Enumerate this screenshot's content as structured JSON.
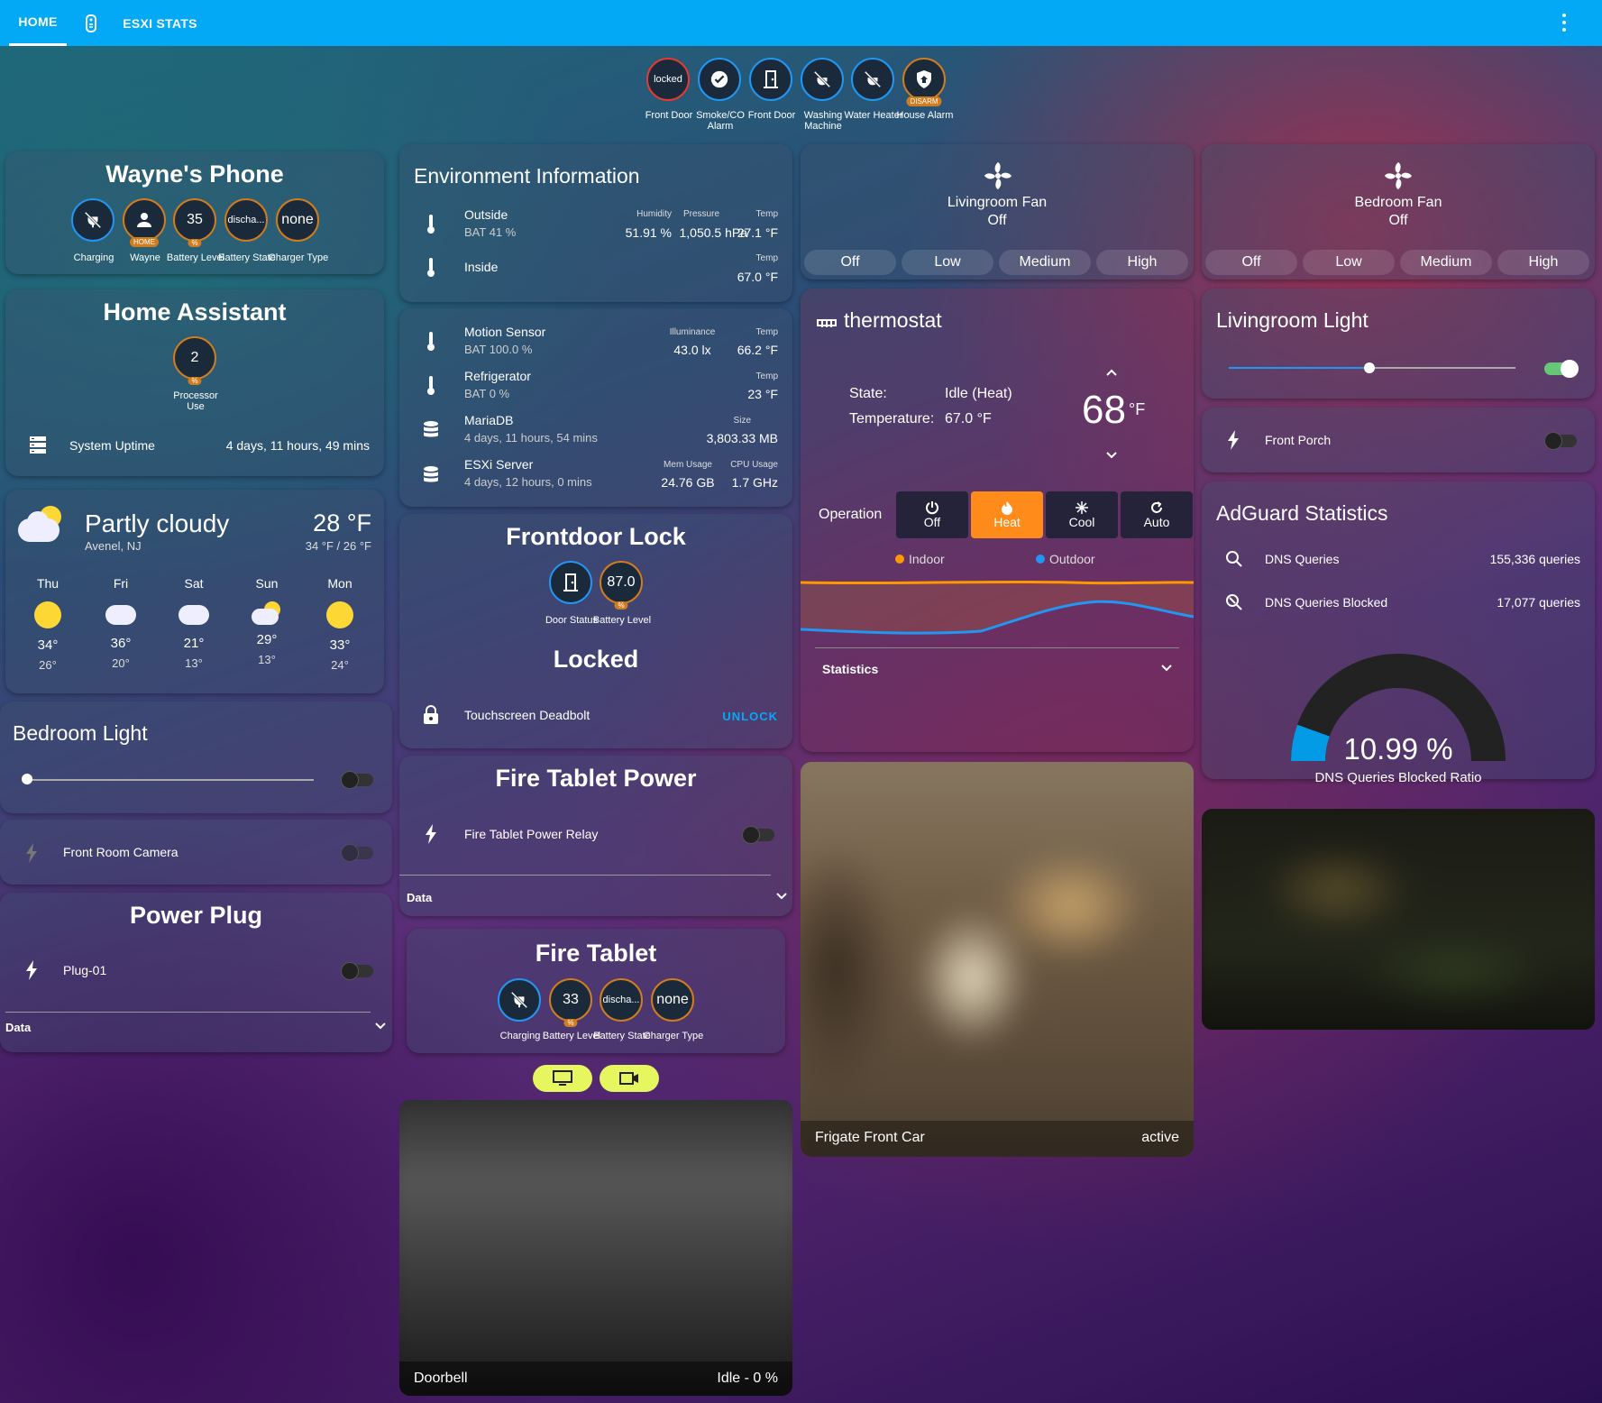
{
  "topbar": {
    "tabs": [
      {
        "label": "HOME"
      },
      {
        "label": "ESXI STATS"
      }
    ]
  },
  "status_badges": [
    {
      "value": "locked",
      "label": "Front Door",
      "icon": "lock-icon"
    },
    {
      "value": "",
      "label": "Smoke/CO Alarm",
      "icon": "check-icon"
    },
    {
      "value": "",
      "label": "Front Door",
      "icon": "door-icon"
    },
    {
      "value": "",
      "label": "Washing Machine",
      "icon": "power-off-icon"
    },
    {
      "value": "",
      "label": "Water Heater",
      "icon": "power-off-icon"
    },
    {
      "value": "",
      "label": "House Alarm",
      "icon": "shield-home-icon",
      "chip": "DISARM"
    }
  ],
  "phone": {
    "title": "Wayne's Phone",
    "badges": [
      {
        "value": "",
        "label": "Charging",
        "icon": "power-plug-off-icon"
      },
      {
        "value": "",
        "label": "Wayne",
        "icon": "person-icon",
        "chip": "HOME"
      },
      {
        "value": "35",
        "label": "Battery Level",
        "chip": "%"
      },
      {
        "value": "discha...",
        "label": "Battery State"
      },
      {
        "value": "none",
        "label": "Charger Type"
      }
    ]
  },
  "ha": {
    "title": "Home Assistant",
    "badge": {
      "value": "2",
      "label": "Processor Use",
      "chip": "%"
    },
    "uptime_label": "System Uptime",
    "uptime_value": "4 days, 11 hours, 49 mins"
  },
  "weather": {
    "condition": "Partly cloudy",
    "location": "Avenel, NJ",
    "temp": "28 °F",
    "hilo": "34 °F / 26 °F",
    "forecast": [
      {
        "day": "Thu",
        "high": "34°",
        "low": "26°",
        "icon": "sunny"
      },
      {
        "day": "Fri",
        "high": "36°",
        "low": "20°",
        "icon": "snowy"
      },
      {
        "day": "Sat",
        "high": "21°",
        "low": "13°",
        "icon": "snowy"
      },
      {
        "day": "Sun",
        "high": "29°",
        "low": "13°",
        "icon": "partly-cloudy"
      },
      {
        "day": "Mon",
        "high": "33°",
        "low": "24°",
        "icon": "sunny"
      }
    ]
  },
  "bedroom_light": {
    "title": "Bedroom Light",
    "level": 0,
    "on": false
  },
  "front_room_camera": {
    "label": "Front Room Camera",
    "on": false
  },
  "power_plug": {
    "title": "Power Plug",
    "item": "Plug-01",
    "on": false,
    "footer": "Data"
  },
  "env": {
    "title": "Environment Information",
    "outside": {
      "name": "Outside",
      "bat": "BAT 41 %",
      "h_label": "Humidity",
      "h": "51.91 %",
      "p_label": "Pressure",
      "p": "1,050.5 hPa",
      "t_label": "Temp",
      "t": "27.1 °F"
    },
    "inside": {
      "name": "Inside",
      "t_label": "Temp",
      "t": "67.0 °F"
    }
  },
  "sensors": {
    "motion": {
      "name": "Motion Sensor",
      "bat": "BAT 100.0 %",
      "i_label": "Illuminance",
      "i": "43.0 lx",
      "t_label": "Temp",
      "t": "66.2 °F"
    },
    "fridge": {
      "name": "Refrigerator",
      "bat": "BAT 0 %",
      "t_label": "Temp",
      "t": "23 °F"
    },
    "mariadb": {
      "name": "MariaDB",
      "sub": "4 days, 11 hours, 54 mins",
      "s_label": "Size",
      "s": "3,803.33 MB"
    },
    "esxi": {
      "name": "ESXi Server",
      "sub": "4 days, 12 hours, 0 mins",
      "m_label": "Mem Usage",
      "m": "24.76 GB",
      "c_label": "CPU Usage",
      "c": "1.7 GHz"
    }
  },
  "lock": {
    "title": "Frontdoor Lock",
    "badges": [
      {
        "value": "",
        "label": "Door Status",
        "icon": "door-icon"
      },
      {
        "value": "87.0",
        "label": "Battery Level",
        "chip": "%"
      }
    ],
    "state": "Locked",
    "row_label": "Touchscreen Deadbolt",
    "action": "UNLOCK"
  },
  "tablet_power": {
    "title": "Fire Tablet Power",
    "item": "Fire Tablet Power Relay",
    "on": false,
    "footer": "Data"
  },
  "tablet": {
    "title": "Fire Tablet",
    "badges": [
      {
        "value": "",
        "label": "Charging",
        "icon": "power-plug-off-icon"
      },
      {
        "value": "33",
        "label": "Battery Level",
        "chip": "%"
      },
      {
        "value": "discha...",
        "label": "Battery State"
      },
      {
        "value": "none",
        "label": "Charger Type"
      }
    ]
  },
  "doorbell": {
    "name": "Doorbell",
    "state": "Idle - 0 %"
  },
  "lr_fan": {
    "name": "Livingroom Fan",
    "state": "Off",
    "buttons": [
      "Off",
      "Low",
      "Medium",
      "High"
    ]
  },
  "bd_fan": {
    "name": "Bedroom Fan",
    "state": "Off",
    "buttons": [
      "Off",
      "Low",
      "Medium",
      "High"
    ]
  },
  "thermostat": {
    "title": "thermostat",
    "state_label": "State:",
    "state": "Idle (Heat)",
    "temp_label": "Temperature:",
    "temp": "67.0 °F",
    "setpoint": "68",
    "unit": "°F",
    "operation_label": "Operation",
    "modes": [
      "Off",
      "Heat",
      "Cool",
      "Auto"
    ],
    "active_mode": "Heat",
    "legend": [
      "Indoor",
      "Outdoor"
    ],
    "footer": "Statistics",
    "colors": {
      "indoor": "#ff9800",
      "outdoor": "#2196f3"
    }
  },
  "lr_light": {
    "title": "Livingroom Light",
    "level": 0.49,
    "on": true
  },
  "front_porch": {
    "label": "Front Porch",
    "on": false
  },
  "adguard": {
    "title": "AdGuard Statistics",
    "q_label": "DNS Queries",
    "q": "155,336 queries",
    "b_label": "DNS Queries Blocked",
    "b": "17,077 queries",
    "ratio": "10.99 %",
    "ratio_label": "DNS Queries Blocked Ratio",
    "ratio_value": 10.99
  },
  "frigate": {
    "name": "Frigate Front Car",
    "state": "active"
  }
}
